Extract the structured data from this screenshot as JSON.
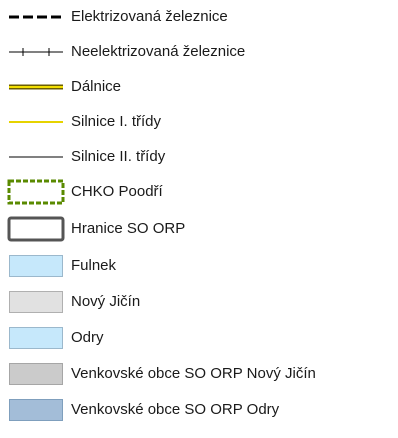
{
  "legend": {
    "items": [
      {
        "label": "Elektrizovaná železnice",
        "symbol": "electrified-railway",
        "color": "#000000"
      },
      {
        "label": "Neelektrizovaná železnice",
        "symbol": "non-electrified-railway",
        "color": "#000000"
      },
      {
        "label": "Dálnice",
        "symbol": "motorway",
        "color": "#c9b300"
      },
      {
        "label": "Silnice I. třídy",
        "symbol": "first-class-road",
        "color": "#e6d300"
      },
      {
        "label": "Silnice II. třídy",
        "symbol": "second-class-road",
        "color": "#000000"
      },
      {
        "label": "CHKO Poodří",
        "symbol": "protected-landscape-area",
        "color": "#5a8a00",
        "fill": "#ffffff"
      },
      {
        "label": "Hranice SO ORP",
        "symbol": "orp-boundary",
        "color": "#555555",
        "fill": "#ffffff"
      },
      {
        "label": "Fulnek",
        "symbol": "area-fulnek",
        "color": "#9bb8cc",
        "fill": "#c6e8fb"
      },
      {
        "label": "Nový Jičín",
        "symbol": "area-novy-jicin",
        "color": "#b0b0b0",
        "fill": "#e1e1e1"
      },
      {
        "label": "Odry",
        "symbol": "area-odry",
        "color": "#9bb8cc",
        "fill": "#c6e8fb"
      },
      {
        "label": "Venkovské obce SO ORP Nový Jičín",
        "symbol": "area-rural-novy-jicin",
        "color": "#a6a6a6",
        "fill": "#cbcbcb"
      },
      {
        "label": "Venkovské obce SO ORP Odry",
        "symbol": "area-rural-odry",
        "color": "#7f9fbd",
        "fill": "#a3bdd8"
      }
    ]
  }
}
